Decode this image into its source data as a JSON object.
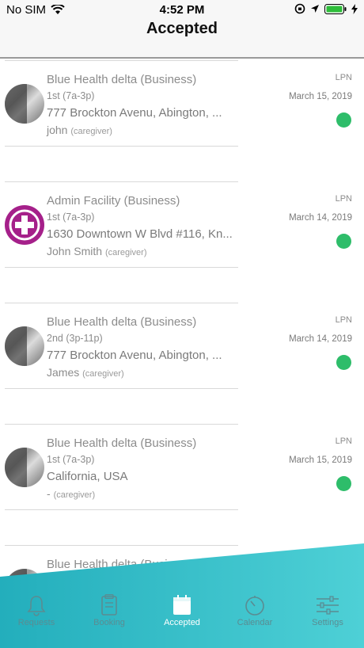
{
  "status_bar": {
    "carrier": "No SIM",
    "time": "4:52 PM"
  },
  "nav": {
    "title": "Accepted"
  },
  "shifts": [
    {
      "facility": "Blue Health delta (Business)",
      "shift": "1st (7a-3p)",
      "address": "777 Brockton Avenu, Abington, ...",
      "person": "john",
      "role": "(caregiver)",
      "type": "LPN",
      "date": "March 15, 2019",
      "avatar": "photo"
    },
    {
      "facility": "Admin Facility (Business)",
      "shift": "1st (7a-3p)",
      "address": "1630 Downtown W Blvd #116, Kn...",
      "person": "John Smith",
      "role": "(caregiver)",
      "type": "LPN",
      "date": "March 14, 2019",
      "avatar": "admin"
    },
    {
      "facility": "Blue Health delta (Business)",
      "shift": "2nd (3p-11p)",
      "address": "777 Brockton Avenu, Abington, ...",
      "person": "James",
      "role": "(caregiver)",
      "type": "LPN",
      "date": "March 14, 2019",
      "avatar": "photo"
    },
    {
      "facility": "Blue Health delta (Business)",
      "shift": "1st (7a-3p)",
      "address": "California, USA",
      "person": "-",
      "role": "(caregiver)",
      "type": "LPN",
      "date": "March 15, 2019",
      "avatar": "photo"
    },
    {
      "facility": "Blue Health delta (Business)",
      "shift": "",
      "address": "",
      "person": "",
      "role": "",
      "type": "",
      "date": "",
      "avatar": "photo"
    }
  ],
  "tabs": [
    {
      "label": "Requests",
      "icon": "bell-icon",
      "active": false
    },
    {
      "label": "Booking",
      "icon": "clipboard-icon",
      "active": false
    },
    {
      "label": "Accepted",
      "icon": "calendar-icon",
      "active": true
    },
    {
      "label": "Calendar",
      "icon": "clock-icon",
      "active": false
    },
    {
      "label": "Settings",
      "icon": "sliders-icon",
      "active": false
    }
  ],
  "colors": {
    "accent": "#3ec6cf",
    "status_dot": "#2ebd6a",
    "admin_avatar": "#a5208a"
  }
}
